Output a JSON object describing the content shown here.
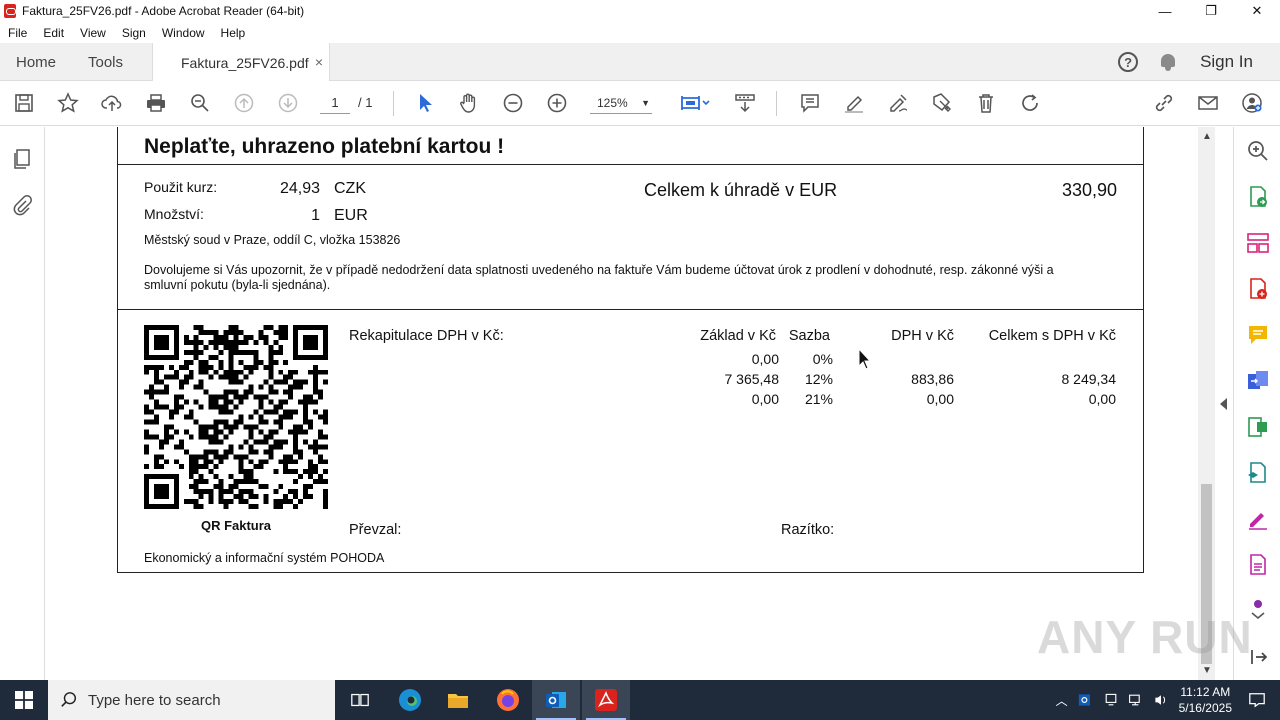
{
  "window": {
    "title": "Faktura_25FV26.pdf - Adobe Acrobat Reader (64-bit)",
    "minimize": "—",
    "maximize": "❐",
    "close": "✕"
  },
  "menu": [
    "File",
    "Edit",
    "View",
    "Sign",
    "Window",
    "Help"
  ],
  "tabs": {
    "home": "Home",
    "tools": "Tools",
    "document": "Faktura_25FV26.pdf",
    "close": "×"
  },
  "header": {
    "help": "?",
    "signin": "Sign In"
  },
  "toolbar": {
    "page_current": "1",
    "page_total": "/  1",
    "zoom": "125%",
    "zoom_arrow": "▼"
  },
  "document": {
    "heading": "Neplaťte, uhrazeno platební kartou !",
    "rate_label": "Použit kurz:",
    "rate_value": "24,93",
    "rate_currency": "CZK",
    "quantity_label": "Množství:",
    "quantity_value": "1",
    "quantity_currency": "EUR",
    "total_label": "Celkem k úhradě v EUR",
    "total_value": "330,90",
    "court": "Městský soud v Praze, oddíl C, vložka 153826",
    "notice_line1": "Dovolujeme si Vás upozornit, že v případě nedodržení data splatnosti uvedeného na faktuře Vám budeme účtovat úrok z prodlení v dohodnuté, resp. zákonné výši a",
    "notice_line2": "smluvní pokutu (byla-li sjednána).",
    "vat_title": "Rekapitulace DPH v Kč:",
    "vat_headers": [
      "Základ v Kč",
      "Sazba",
      "DPH v Kč",
      "Celkem s  DPH v Kč"
    ],
    "vat_rows": [
      [
        "0,00",
        "0%",
        "",
        ""
      ],
      [
        "7 365,48",
        "12%",
        "883,86",
        "8 249,34"
      ],
      [
        "0,00",
        "21%",
        "0,00",
        "0,00"
      ]
    ],
    "qr_label": "QR Faktura",
    "received_label": "Převzal:",
    "stamp_label": "Razítko:",
    "footer": "Ekonomický a informační systém POHODA"
  },
  "scrollbar": {
    "up": "▲",
    "down": "▼"
  },
  "watermark": "ANY RUN",
  "taskbar": {
    "search_placeholder": "Type here to search",
    "time": "11:12 AM",
    "date": "5/16/2025"
  },
  "colors": {
    "acrobat_red": "#d9231c",
    "tool_blue": "#2b6cd8",
    "right_panel_green": "#2e9b52",
    "right_panel_pink": "#d9267a",
    "taskbar": "#1f2a3a"
  }
}
